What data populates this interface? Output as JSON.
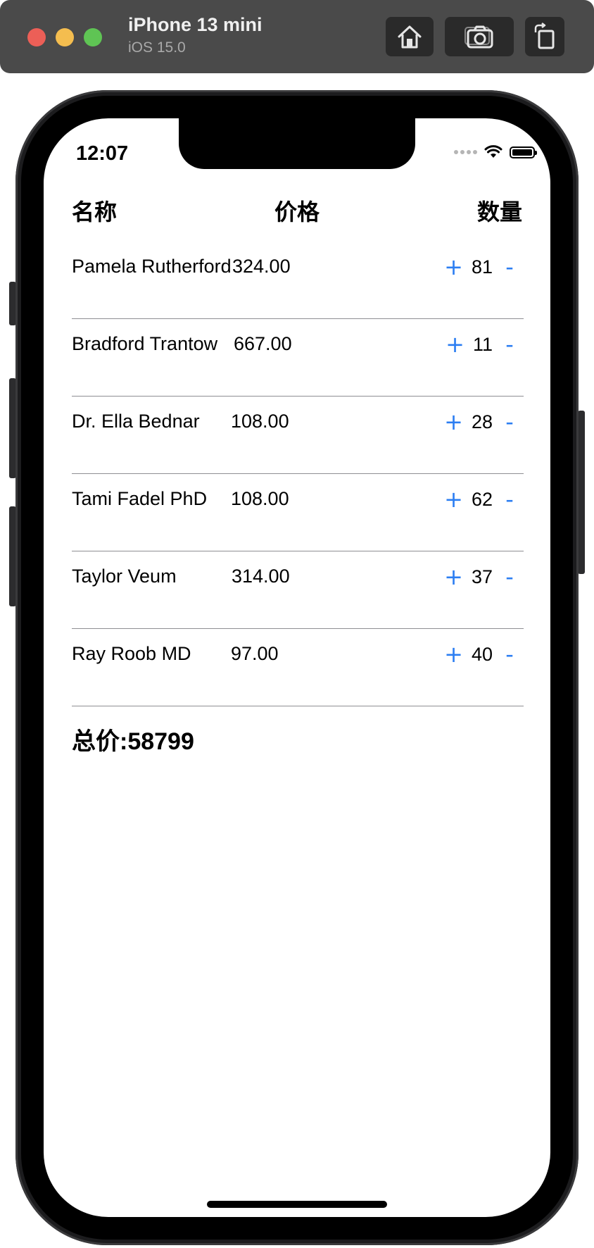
{
  "simulator": {
    "device_name": "iPhone 13 mini",
    "os_version": "iOS 15.0",
    "buttons": [
      "home-icon",
      "camera-icon",
      "rotate-icon"
    ]
  },
  "status_bar": {
    "time": "12:07"
  },
  "table": {
    "headers": {
      "name": "名称",
      "price": "价格",
      "quantity": "数量"
    },
    "rows": [
      {
        "name": "Pamela Rutherford",
        "price": "324.00",
        "quantity": "81",
        "plus": "+",
        "minus": "-"
      },
      {
        "name": "Bradford Trantow",
        "price": "667.00",
        "quantity": "11",
        "plus": "+",
        "minus": "-"
      },
      {
        "name": "Dr. Ella Bednar",
        "price": "108.00",
        "quantity": "28",
        "plus": "+",
        "minus": "-"
      },
      {
        "name": "Tami Fadel PhD",
        "price": "108.00",
        "quantity": "62",
        "plus": "+",
        "minus": "-"
      },
      {
        "name": "Taylor Veum",
        "price": "314.00",
        "quantity": "37",
        "plus": "+",
        "minus": "-"
      },
      {
        "name": "Ray Roob MD",
        "price": "97.00",
        "quantity": "40",
        "plus": "+",
        "minus": "-"
      }
    ]
  },
  "total": {
    "text": "总价:58799"
  },
  "colors": {
    "accent": "#2c7ef2",
    "divider": "#8e8e93",
    "sim_bar": "#4a4a4a"
  }
}
